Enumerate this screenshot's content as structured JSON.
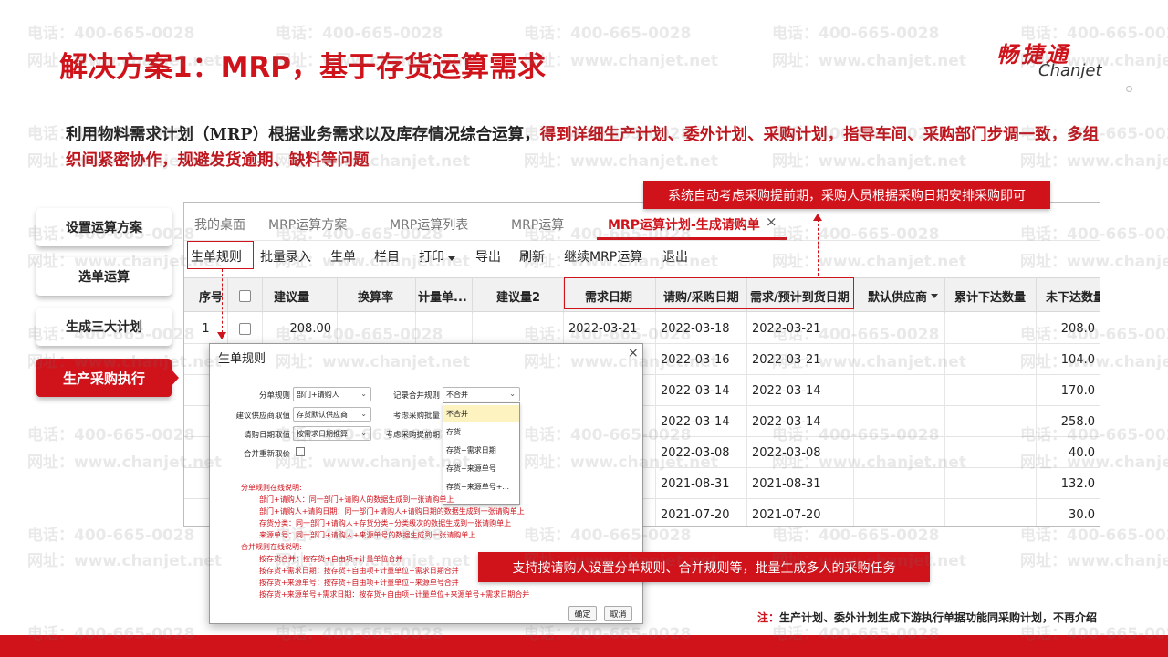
{
  "slide": {
    "title": "解决方案1：MRP，基于存货运算需求",
    "logo_cn": "畅捷通",
    "logo_en": "Chanjet",
    "watermark_phone": "电话：400-665-0028",
    "watermark_site": "网址：www.chanjet.net",
    "description_plain": "利用物料需求计划（MRP）根据业务需求以及库存情况综合运算，",
    "description_highlight": "得到详细生产计划、委外计划、采购计划，指导车间、采购部门步调一致，多组织间紧密协作，规避发货逾期、缺料等问题",
    "steps": [
      {
        "label": "设置运算方案"
      },
      {
        "label": "选单运算"
      },
      {
        "label": "生成三大计划"
      },
      {
        "label": "生产采购执行"
      }
    ],
    "callout_top": "系统自动考虑采购提前期，采购人员根据采购日期安排采购即可",
    "callout_bottom": "支持按请购人设置分单规则、合并规则等，批量生成多人的采购任务",
    "footnote_prefix": "注：",
    "footnote_text": "生产计划、委外计划生成下游执行单据功能同采购计划，不再介绍",
    "accent_color": "#d0121b"
  },
  "app": {
    "tabs": [
      {
        "label": "我的桌面"
      },
      {
        "label": "MRP运算方案"
      },
      {
        "label": "MRP运算列表"
      },
      {
        "label": "MRP运算"
      },
      {
        "label": "MRP运算计划-生成请购单"
      }
    ],
    "tab_close": "×",
    "toolbar": [
      {
        "label": "生单规则"
      },
      {
        "label": "批量录入"
      },
      {
        "label": "生单"
      },
      {
        "label": "栏目"
      },
      {
        "label": "打印"
      },
      {
        "label": "导出"
      },
      {
        "label": "刷新"
      },
      {
        "label": "继续MRP运算"
      },
      {
        "label": "退出"
      }
    ],
    "columns": [
      "序号",
      "",
      "建议量",
      "换算率",
      "计量单...",
      "建议量2",
      "需求日期",
      "请购/采购日期",
      "需求/预计到货日期",
      "默认供应商",
      "累计下达数量",
      "未下达数量"
    ],
    "rows": [
      {
        "seq": "1",
        "qty": "208.00",
        "demand_date": "2022-03-21",
        "purchase_date": "2022-03-18",
        "arrival_date": "2022-03-21",
        "remaining": "208.0"
      },
      {
        "seq": "",
        "qty": "",
        "demand_date": "",
        "purchase_date": "2022-03-16",
        "arrival_date": "2022-03-21",
        "remaining": "104.0"
      },
      {
        "seq": "",
        "qty": "",
        "demand_date": "",
        "purchase_date": "2022-03-14",
        "arrival_date": "2022-03-14",
        "remaining": "170.0"
      },
      {
        "seq": "",
        "qty": "",
        "demand_date": "",
        "purchase_date": "2022-03-14",
        "arrival_date": "2022-03-14",
        "remaining": "258.0"
      },
      {
        "seq": "",
        "qty": "",
        "demand_date": "",
        "purchase_date": "2022-03-08",
        "arrival_date": "2022-03-08",
        "remaining": "40.0"
      },
      {
        "seq": "",
        "qty": "",
        "demand_date": "",
        "purchase_date": "2021-08-31",
        "arrival_date": "2021-08-31",
        "remaining": "132.0"
      },
      {
        "seq": "",
        "qty": "",
        "demand_date": "",
        "purchase_date": "2021-07-20",
        "arrival_date": "2021-07-20",
        "remaining": "30.0"
      }
    ]
  },
  "dialog": {
    "title": "生单规则",
    "close": "×",
    "fields": {
      "split_rule_label": "分单规则",
      "split_rule_value": "部门+请购人",
      "merge_rule_label": "记录合并规则",
      "merge_rule_value": "不合并",
      "supplier_label": "建议供应商取值",
      "supplier_value": "存货默认供应商",
      "batch_label": "考虑采购批量",
      "date_label": "请购日期取值",
      "date_value": "按需求日期推算",
      "lead_label": "考虑采购提前期",
      "reprice_label": "合并重新取价"
    },
    "dropdown_options": [
      "不合并",
      "存货",
      "存货+需求日期",
      "存货+来源单号",
      "存货+来源单号+..."
    ],
    "notes": [
      "分单规则在线说明:",
      "部门+请购人：同一部门+请购人的数据生成到一张请购单上",
      "部门+请购人+请购日期：同一部门+请购人+请购日期的数据生成到一张请购单上",
      "存货分类：同一部门+请购人+存货分类+分类级次的数据生成到一张请购单上",
      "来源单号：同一部门+请购人+来源单号的数据生成到一张请购单上",
      "合并规则在线说明:",
      "按存货合并：按存货+自由项+计量单位合并",
      "按存货+需求日期：按存货+自由项+计量单位+需求日期合并",
      "按存货+来源单号：按存货+自由项+计量单位+来源单号合并",
      "按存货+来源单号+需求日期：按存货+自由项+计量单位+来源单号+需求日期合并"
    ],
    "ok": "确定",
    "cancel": "取消"
  }
}
